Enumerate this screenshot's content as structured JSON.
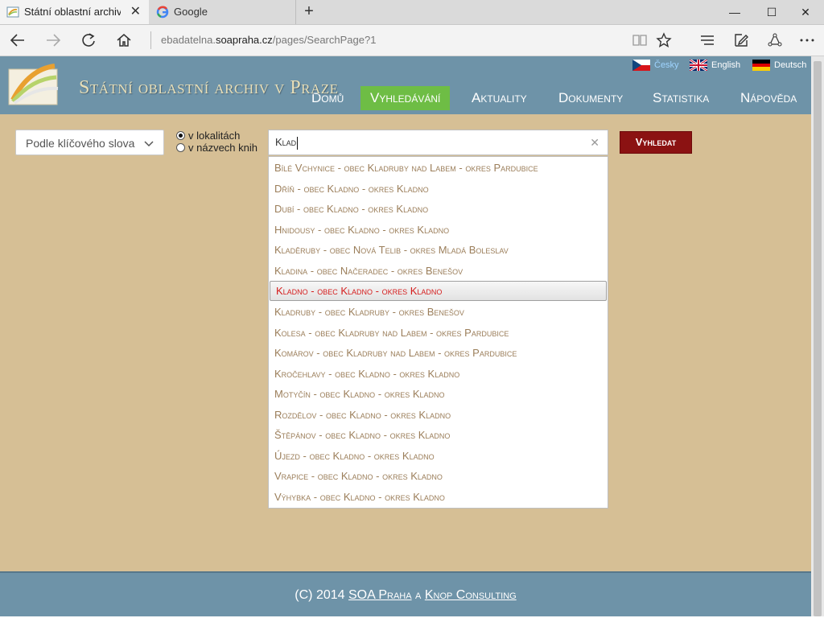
{
  "browser": {
    "tabs": [
      {
        "title": "Státní oblastní archiv v P",
        "active": true
      },
      {
        "title": "Google",
        "active": false
      }
    ],
    "url_prefix": "ebadatelna.",
    "url_domain": "soapraha.cz",
    "url_path": "/pages/SearchPage?1"
  },
  "site": {
    "title": "Státní oblastní archiv v Praze",
    "languages": [
      "Česky",
      "English",
      "Deutsch"
    ],
    "nav": [
      "Domů",
      "Vyhledávání",
      "Aktuality",
      "Dokumenty",
      "Statistika",
      "Nápověda"
    ],
    "nav_selected": "Vyhledávání"
  },
  "search": {
    "mode": "Podle klíčového slova",
    "radio_locations": "v lokalitách",
    "radio_books": "v názvech knih",
    "radio_selected": "v lokalitách",
    "query": "Klad",
    "button": "Vyhledat",
    "suggestions": [
      "Bílé Vchynice - obec Kladruby nad Labem - okres Pardubice",
      "Dříň - obec Kladno - okres Kladno",
      "Dubí - obec Kladno - okres Kladno",
      "Hnidousy - obec Kladno - okres Kladno",
      "Kladěruby - obec Nová Telib - okres Mladá Boleslav",
      "Kladina - obec Načeradec - okres Benešov",
      "Kladno - obec Kladno - okres Kladno",
      "Kladruby - obec Kladruby - okres Benešov",
      "Kolesa - obec Kladruby nad Labem - okres Pardubice",
      "Komárov - obec Kladruby nad Labem - okres Pardubice",
      "Kročehlavy - obec Kladno - okres Kladno",
      "Motyčín - obec Kladno - okres Kladno",
      "Rozdělov - obec Kladno - okres Kladno",
      "Štěpánov - obec Kladno - okres Kladno",
      "Újezd - obec Kladno - okres Kladno",
      "Vrapice - obec Kladno - okres Kladno",
      "Výhybka - obec Kladno - okres Kladno"
    ],
    "highlighted": "Kladno - obec Kladno - okres Kladno"
  },
  "footer": {
    "prefix": "(C) 2014 ",
    "link1": "SOA Praha",
    "middle": " a ",
    "link2": "Knop Consulting"
  },
  "colors": {
    "header": "#6e93a8",
    "content": "#d6bf95",
    "nav_active": "#6ebd45",
    "button": "#8b1212",
    "suggestion_text": "#9b7e5a",
    "suggestion_highlight": "#d51e1e"
  }
}
